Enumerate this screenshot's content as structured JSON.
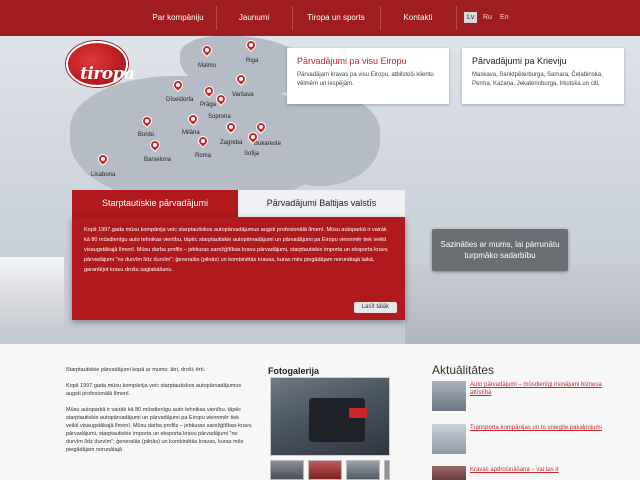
{
  "nav": {
    "items": [
      "Par kompāniju",
      "Jaunumi",
      "Tiropa un sports",
      "Kontakti"
    ],
    "languages": [
      "Lv",
      "Ru",
      "En"
    ],
    "active_language": "Lv"
  },
  "logo": {
    "text": "tiropa"
  },
  "map": {
    "cities": [
      "Malmo",
      "Riga",
      "Varšava",
      "Dīseldorfa",
      "Prāga",
      "Soprona",
      "Bordo",
      "Milāna",
      "Zagreba",
      "Bukareste",
      "Sofija",
      "Barselona",
      "Roma",
      "Lisabona"
    ]
  },
  "infobox_europe": {
    "title": "Pārvadājumi pa visu Eiropu",
    "text": "Pārvadājam kravas pa visu Eiropu, atbilstoši klientu vēlmēm un iespējām."
  },
  "infobox_russia": {
    "title": "Pārvadājumi pa Krieviju",
    "text": "Maskava, Sanktpēterburga, Samara, Čeļabinska, Perma, Kazaņa, Jekaterinburga, Irkutska un citi."
  },
  "tabs": [
    "Starptautiskie pārvadājumi",
    "Pārvadājumi Baltijas valstīs"
  ],
  "active_tab": "Starptautiskie pārvadājumi",
  "panel": {
    "text": "Kopš 1997.gada mūsu kompānija veic starptautiskos autopārvadājumus augsti profesionālā līmenī. Mūsu autoparkā ir vairāk kā 80 mūsdienīgu auto tehnikas vienību, tāpēc starptautiskie autopārvadājumi un pārvadājumi pa Eiropu viennmēr tiek veikti visaugstākajā līmenī. Mūsu darba profils – jebkuras sarežģītības kravu pārvadājumi, starptautiskie importa un eksporta kravu pārvadājumi \"no durvīm līdz durvīm\"; ģeneralās (pilnās) un kombinētās kravas, kuras mēs piegādājam norunātajā laikā, garantējot kravu drošu saglabāšanu.",
    "button": "Lasīt tālāk"
  },
  "contact_button": "Sazināties ar mums, lai pārrunātu turpmāko sadarbību",
  "intro": {
    "p1": "Starptautiskie pārvadājumi kopā ar mums: ātri, droši, ērti.",
    "p2": "Kopš 1997.gada mūsu kompānija veic starptautiskos autopārvadājumus augsti profesionālā līmenī.",
    "p3": "Mūsu autoparkā ir vairāk kā 80 mūsdienīgu auto tehnikas vienību, tāpēc starptautiskie autopārvadājumi un pārvadājumi pa Eiropu viennmēr tiek veikti visaugstākajā līmenī. Mūsu darba profils – jebkuras sarežģītības kravu pārvadājumi, starptautiskie importa un eksporta kravu pārvadājumi \"no durvīm līdz durvīm\"; ģeneralās (pilnās) un kombinētās kravas, kuras mēs piegādājam norunātajā"
  },
  "gallery": {
    "title": "Fotogalerija"
  },
  "news": {
    "title": "Aktuālitātes",
    "items": [
      "Auto pārvadājumi – mūsdienīgi risinājumi biznesa attīstībā",
      "Transporta kompānijas un to sniegtie pakalpojumi",
      "Kravas apdrošināšana – vai tas ir"
    ]
  },
  "colors": {
    "brand_red": "#b0191d",
    "nav_red": "#9f1d20",
    "link_red": "#c8282c"
  }
}
